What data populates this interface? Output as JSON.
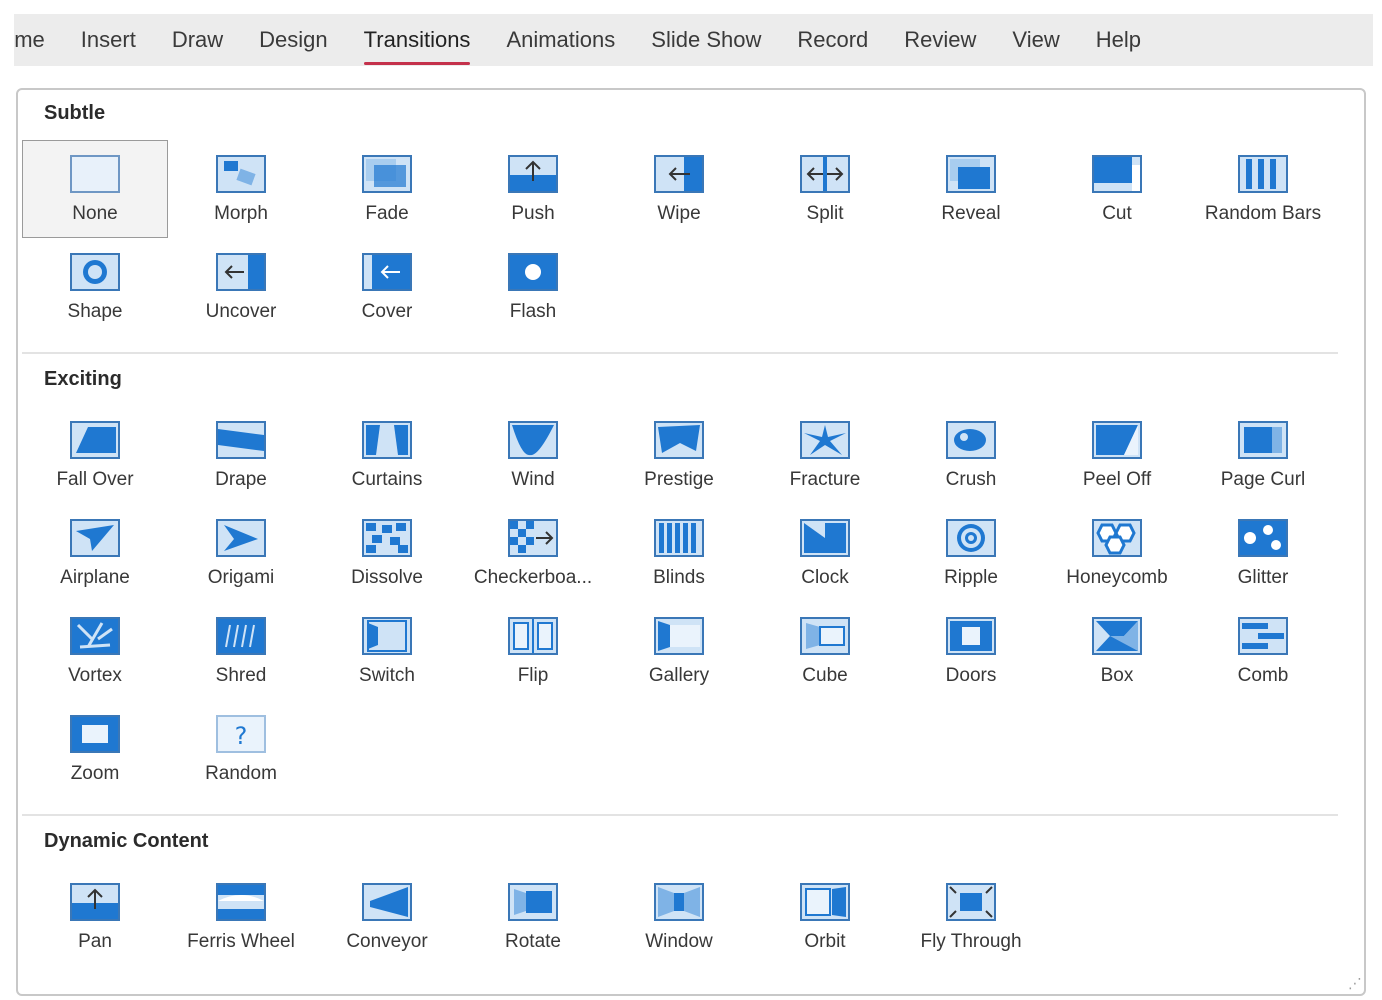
{
  "ribbon": {
    "tabs": [
      "ome",
      "Insert",
      "Draw",
      "Design",
      "Transitions",
      "Animations",
      "Slide Show",
      "Record",
      "Review",
      "View",
      "Help"
    ],
    "active_tab": "Transitions"
  },
  "gallery": {
    "sections": [
      {
        "title": "Subtle",
        "items": [
          {
            "label": "None",
            "icon": "none-icon",
            "selected": true
          },
          {
            "label": "Morph",
            "icon": "morph-icon"
          },
          {
            "label": "Fade",
            "icon": "fade-icon"
          },
          {
            "label": "Push",
            "icon": "push-icon"
          },
          {
            "label": "Wipe",
            "icon": "wipe-icon"
          },
          {
            "label": "Split",
            "icon": "split-icon"
          },
          {
            "label": "Reveal",
            "icon": "reveal-icon"
          },
          {
            "label": "Cut",
            "icon": "cut-icon"
          },
          {
            "label": "Random Bars",
            "icon": "random-bars-icon"
          },
          {
            "label": "Shape",
            "icon": "shape-icon"
          },
          {
            "label": "Uncover",
            "icon": "uncover-icon"
          },
          {
            "label": "Cover",
            "icon": "cover-icon"
          },
          {
            "label": "Flash",
            "icon": "flash-icon"
          }
        ]
      },
      {
        "title": "Exciting",
        "items": [
          {
            "label": "Fall Over",
            "icon": "fall-over-icon"
          },
          {
            "label": "Drape",
            "icon": "drape-icon"
          },
          {
            "label": "Curtains",
            "icon": "curtains-icon"
          },
          {
            "label": "Wind",
            "icon": "wind-icon"
          },
          {
            "label": "Prestige",
            "icon": "prestige-icon"
          },
          {
            "label": "Fracture",
            "icon": "fracture-icon"
          },
          {
            "label": "Crush",
            "icon": "crush-icon"
          },
          {
            "label": "Peel Off",
            "icon": "peel-off-icon"
          },
          {
            "label": "Page Curl",
            "icon": "page-curl-icon"
          },
          {
            "label": "Airplane",
            "icon": "airplane-icon"
          },
          {
            "label": "Origami",
            "icon": "origami-icon"
          },
          {
            "label": "Dissolve",
            "icon": "dissolve-icon"
          },
          {
            "label": "Checkerboa...",
            "icon": "checkerboard-icon"
          },
          {
            "label": "Blinds",
            "icon": "blinds-icon"
          },
          {
            "label": "Clock",
            "icon": "clock-icon"
          },
          {
            "label": "Ripple",
            "icon": "ripple-icon"
          },
          {
            "label": "Honeycomb",
            "icon": "honeycomb-icon"
          },
          {
            "label": "Glitter",
            "icon": "glitter-icon"
          },
          {
            "label": "Vortex",
            "icon": "vortex-icon"
          },
          {
            "label": "Shred",
            "icon": "shred-icon"
          },
          {
            "label": "Switch",
            "icon": "switch-icon"
          },
          {
            "label": "Flip",
            "icon": "flip-icon"
          },
          {
            "label": "Gallery",
            "icon": "gallery-icon"
          },
          {
            "label": "Cube",
            "icon": "cube-icon"
          },
          {
            "label": "Doors",
            "icon": "doors-icon"
          },
          {
            "label": "Box",
            "icon": "box-icon"
          },
          {
            "label": "Comb",
            "icon": "comb-icon"
          },
          {
            "label": "Zoom",
            "icon": "zoom-icon"
          },
          {
            "label": "Random",
            "icon": "random-icon"
          }
        ]
      },
      {
        "title": "Dynamic Content",
        "items": [
          {
            "label": "Pan",
            "icon": "pan-icon"
          },
          {
            "label": "Ferris Wheel",
            "icon": "ferris-wheel-icon"
          },
          {
            "label": "Conveyor",
            "icon": "conveyor-icon"
          },
          {
            "label": "Rotate",
            "icon": "rotate-icon"
          },
          {
            "label": "Window",
            "icon": "window-icon"
          },
          {
            "label": "Orbit",
            "icon": "orbit-icon"
          },
          {
            "label": "Fly Through",
            "icon": "fly-through-icon"
          }
        ]
      }
    ]
  },
  "colors": {
    "icon_border": "#3a77b7",
    "icon_fill": "#cfe3f6",
    "icon_accent": "#1f78d1",
    "active_tab_underline": "#c4314b"
  }
}
